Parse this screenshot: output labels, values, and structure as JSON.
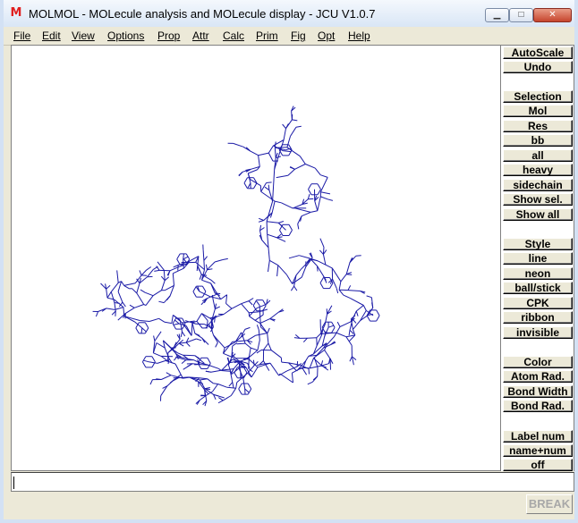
{
  "window": {
    "title": "MOLMOL - MOLecule analysis and MOLecule display - JCU V1.0.7",
    "app_icon_letter": "M",
    "minimize_glyph": "▁",
    "maximize_glyph": "□",
    "close_glyph": "✕"
  },
  "menu": [
    "File",
    "Edit",
    "View",
    "Options",
    "Prop",
    "Attr",
    "Calc",
    "Prim",
    "Fig",
    "Opt",
    "Help"
  ],
  "panel": {
    "buttons": [
      "AutoScale",
      "Undo",
      "Selection",
      "Mol",
      "Res",
      "bb",
      "all",
      "heavy",
      "sidechain",
      "Show sel.",
      "Show all",
      "Style",
      "line",
      "neon",
      "ball/stick",
      "CPK",
      "ribbon",
      "invisible",
      "Color",
      "Atom Rad.",
      "Bond Width",
      "Bond Rad.",
      "Label num",
      "name+num",
      "off"
    ]
  },
  "command_line": {
    "value": ""
  },
  "status": {
    "break_label": "BREAK"
  },
  "colors": {
    "bond": "#1a1aa6",
    "canvas_bg": "#ffffff",
    "window_bg": "#ece9d8"
  }
}
